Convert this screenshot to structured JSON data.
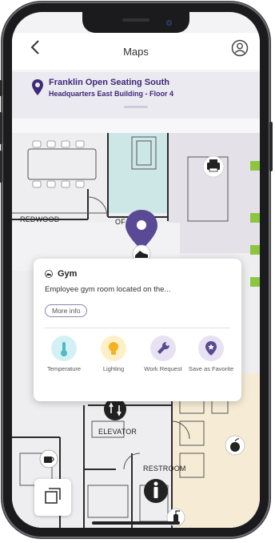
{
  "header": {
    "title": "Maps"
  },
  "location": {
    "title": "Franklin Open Seating South",
    "subtitle": "Headquarters East Building - Floor 4"
  },
  "map_labels": {
    "redwood": "REDWOOD",
    "of": "OF",
    "elevator": "ELEVATOR",
    "restroom": "RESTROOM"
  },
  "card": {
    "title": "Gym",
    "description": "Employee gym room located on the...",
    "more_info": "More info",
    "actions": [
      {
        "label": "Temperature",
        "icon": "thermometer-icon",
        "color": "#d3f1f4"
      },
      {
        "label": "Lighting",
        "icon": "lightbulb-icon",
        "color": "#fdf0c9"
      },
      {
        "label": "Work Request",
        "icon": "wrench-icon",
        "color": "#e6e2f2"
      },
      {
        "label": "Save as Favorite",
        "icon": "star-pin-icon",
        "color": "#e6e2f2"
      }
    ]
  },
  "colors": {
    "accent": "#5a4a96",
    "brand_dark": "#3e2a78",
    "room_teal": "#cde6e6",
    "room_beige": "#f6ecd6",
    "green_marker": "#8cc63f"
  }
}
